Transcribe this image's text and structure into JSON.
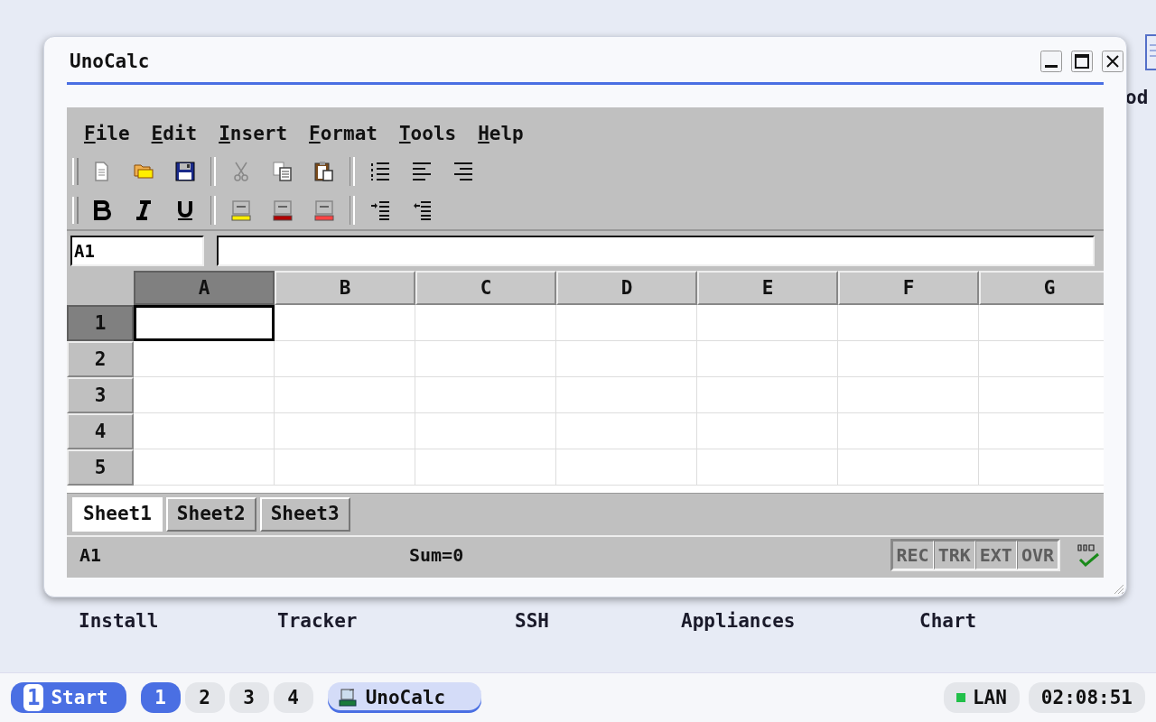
{
  "desktop": {
    "labels": [
      {
        "text": "Install"
      },
      {
        "text": "Tracker"
      },
      {
        "text": "SSH"
      },
      {
        "text": "Appliances"
      },
      {
        "text": "Chart"
      }
    ],
    "edge_label": "od"
  },
  "window": {
    "title": "UnoCalc"
  },
  "menu": [
    {
      "label": "File"
    },
    {
      "label": "Edit"
    },
    {
      "label": "Insert"
    },
    {
      "label": "Format"
    },
    {
      "label": "Tools"
    },
    {
      "label": "Help"
    }
  ],
  "toolbars": [
    [
      [
        {
          "kind": "new"
        },
        {
          "kind": "open"
        },
        {
          "kind": "save"
        }
      ],
      [
        {
          "kind": "cut"
        },
        {
          "kind": "copy"
        },
        {
          "kind": "paste"
        }
      ],
      [
        {
          "kind": "list"
        },
        {
          "kind": "align-left"
        },
        {
          "kind": "align-right"
        }
      ]
    ],
    [
      [
        {
          "kind": "bold"
        },
        {
          "kind": "italic"
        },
        {
          "kind": "underline"
        }
      ],
      [
        {
          "kind": "highlight-yellow"
        },
        {
          "kind": "highlight-darkred"
        },
        {
          "kind": "highlight-red"
        }
      ],
      [
        {
          "kind": "indent"
        },
        {
          "kind": "outdent"
        }
      ]
    ]
  ],
  "name_box": {
    "value": "A1"
  },
  "columns": [
    {
      "label": "A",
      "selected": true
    },
    {
      "label": "B",
      "selected": false
    },
    {
      "label": "C",
      "selected": false
    },
    {
      "label": "D",
      "selected": false
    },
    {
      "label": "E",
      "selected": false
    },
    {
      "label": "F",
      "selected": false
    },
    {
      "label": "G",
      "selected": false
    }
  ],
  "rows": [
    {
      "label": "1",
      "selected": true
    },
    {
      "label": "2",
      "selected": false
    },
    {
      "label": "3",
      "selected": false
    },
    {
      "label": "4",
      "selected": false
    },
    {
      "label": "5",
      "selected": false
    }
  ],
  "sheet_tabs": [
    {
      "label": "Sheet1",
      "selected": true
    },
    {
      "label": "Sheet2",
      "selected": false
    },
    {
      "label": "Sheet3",
      "selected": false
    }
  ],
  "status_bar": {
    "cell": "A1",
    "sum": "Sum=0",
    "indicators": [
      {
        "label": "REC",
        "on": false
      },
      {
        "label": "TRK",
        "on": false
      },
      {
        "label": "EXT",
        "on": false
      },
      {
        "label": "OVR",
        "on": false
      }
    ]
  },
  "taskbar": {
    "start": {
      "badge": "1",
      "label": "Start"
    },
    "workspaces": [
      {
        "label": "1",
        "selected": true
      },
      {
        "label": "2",
        "selected": false
      },
      {
        "label": "3",
        "selected": false
      },
      {
        "label": "4",
        "selected": false
      }
    ],
    "tasks": [
      {
        "label": "UnoCalc",
        "selected": true
      }
    ],
    "network": {
      "label": "LAN",
      "on": true
    },
    "clock": "02:08:51"
  }
}
